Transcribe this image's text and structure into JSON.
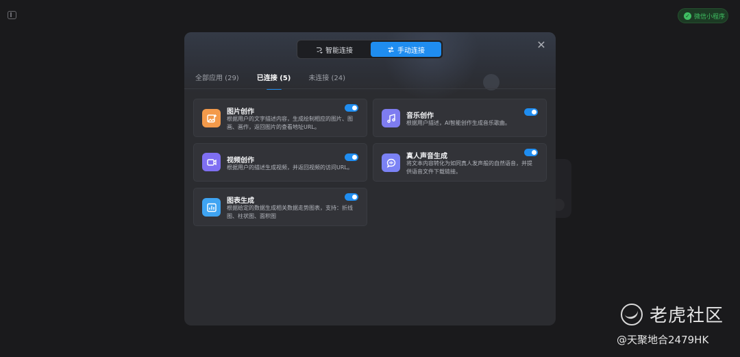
{
  "header": {
    "mini_program_label": "微信小程序"
  },
  "modal": {
    "segmented": [
      {
        "label": "智能连接",
        "icon": "smart-link-icon",
        "active": false
      },
      {
        "label": "手动连接",
        "icon": "manual-link-icon",
        "active": true
      }
    ],
    "close_icon": "close-icon",
    "tabs": [
      {
        "label": "全部应用 (29)",
        "active": false
      },
      {
        "label": "已连接 (5)",
        "active": true
      },
      {
        "label": "未连接 (24)",
        "active": false
      }
    ],
    "apps": [
      {
        "name": "图片创作",
        "desc": "根据用户的文字描述内容，生成绘制相应的图片、图画、画作，返回图片的查看地址URL。",
        "icon": "image-icon",
        "color": "#f39a4b",
        "enabled": true
      },
      {
        "name": "音乐创作",
        "desc": "根据用户描述，AI智能创作生成音乐歌曲。",
        "icon": "music-icon",
        "color": "#7e7cf0",
        "enabled": true
      },
      {
        "name": "视频创作",
        "desc": "根据用户的描述生成视频，并返回视频的访问URL。",
        "icon": "video-icon",
        "color": "#7f6ff2",
        "enabled": true
      },
      {
        "name": "真人声音生成",
        "desc": "将文本内容转化为如同真人发声般的自然语音，并提供语音文件下载链接。",
        "icon": "voice-chat-icon",
        "color": "#7b82f5",
        "enabled": true
      },
      {
        "name": "图表生成",
        "desc": "根据给定的数据生成相关数据走势图表，支持：折线图、柱状图、面积图",
        "icon": "chart-icon",
        "color": "#3fa4f2",
        "enabled": true
      }
    ]
  },
  "watermark": {
    "brand": "老虎社区",
    "handle": "@天聚地合2479HK"
  },
  "colors": {
    "accent": "#1f8df0",
    "modal_bg": "#2b2c30",
    "card_bg": "#323338",
    "mini_program_green": "#3fbf62"
  }
}
